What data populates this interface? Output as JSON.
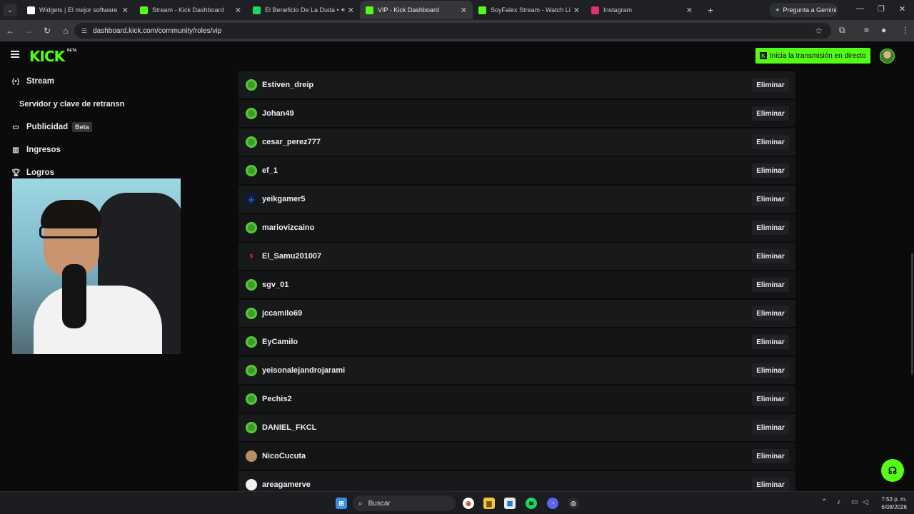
{
  "browser": {
    "tabs": [
      {
        "title": "Widgets | El mejor software pa",
        "favicon_color": "#ffffff"
      },
      {
        "title": "Stream - Kick Dashboard",
        "favicon_color": "#53fc18"
      },
      {
        "title": "El Beneficio De La Duda • G",
        "favicon_color": "#1ed760"
      },
      {
        "title": "VIP - Kick Dashboard",
        "favicon_color": "#53fc18"
      },
      {
        "title": "SoyFalex Stream - Watch Live o",
        "favicon_color": "#53fc18"
      },
      {
        "title": "Instagram",
        "favicon_color": "#e1306c"
      }
    ],
    "gemini_label": "Pregunta a Gemini",
    "url": "dashboard.kick.com/community/roles/vip"
  },
  "header": {
    "logo": "KICK",
    "logo_badge": "BETA",
    "go_live_label": "Inicia la transmisión en directo"
  },
  "sidebar": {
    "items": [
      {
        "label": "Stream",
        "icon": "broadcast-icon"
      },
      {
        "label": "Servidor y clave de retransn",
        "icon": ""
      },
      {
        "label": "Publicidad",
        "icon": "ad-icon",
        "badge": "Beta"
      },
      {
        "label": "Ingresos",
        "icon": "chart-icon"
      },
      {
        "label": "Logros",
        "icon": "trophy-icon"
      }
    ]
  },
  "vip_list": {
    "remove_label": "Eliminar",
    "users": [
      {
        "name": "Estiven_dreip",
        "avatar": "green"
      },
      {
        "name": "Johan49",
        "avatar": "green"
      },
      {
        "name": "cesar_perez777",
        "avatar": "green"
      },
      {
        "name": "ef_1",
        "avatar": "green"
      },
      {
        "name": "yeikgamer5",
        "avatar": "blue"
      },
      {
        "name": "mariovizcaino",
        "avatar": "green"
      },
      {
        "name": "El_Samu201007",
        "avatar": "red"
      },
      {
        "name": "sgv_01",
        "avatar": "green"
      },
      {
        "name": "jccamilo69",
        "avatar": "green"
      },
      {
        "name": "EyCamilo",
        "avatar": "green"
      },
      {
        "name": "yeisonalejandrojarami",
        "avatar": "green"
      },
      {
        "name": "Pechis2",
        "avatar": "green"
      },
      {
        "name": "DANIEL_FKCL",
        "avatar": "green"
      },
      {
        "name": "NicoCucuta",
        "avatar": "face"
      },
      {
        "name": "areagamerve",
        "avatar": "faceb"
      }
    ]
  },
  "taskbar": {
    "search_placeholder": "Buscar",
    "time": "7:53 p. m.",
    "date": "6/08/2026"
  }
}
